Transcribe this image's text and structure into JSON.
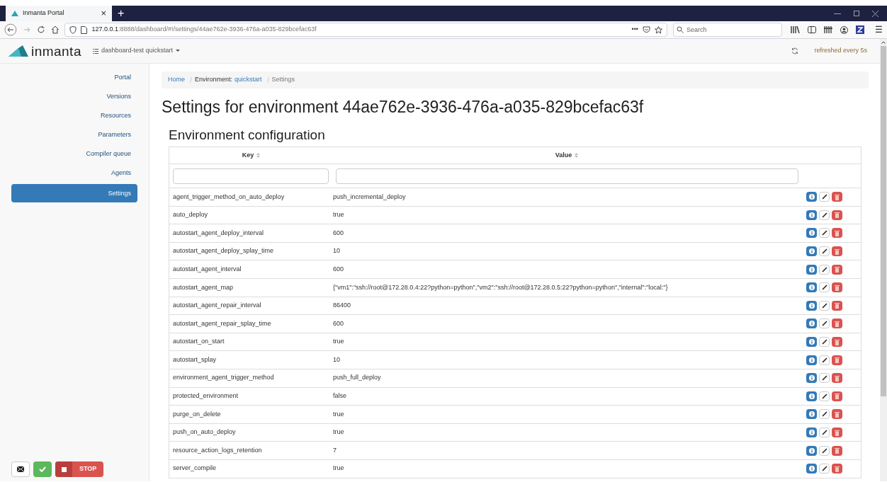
{
  "browser": {
    "tab_title": "Inmanta Portal",
    "close": "×",
    "new_tab": "+",
    "url_host": "127.0.0.1",
    "url_rest": ":8888/dashboard/#!/settings/44ae762e-3936-476a-a035-829bcefac63f",
    "more": "•••",
    "search_placeholder": "Search",
    "menu": "☰"
  },
  "header": {
    "logo": "inmanta",
    "environment": "dashboard-test quickstart",
    "refresh_status": "refreshed every 5s"
  },
  "sidebar": {
    "items": [
      {
        "label": "Portal",
        "selected": false
      },
      {
        "label": "Versions",
        "selected": false
      },
      {
        "label": "Resources",
        "selected": false
      },
      {
        "label": "Parameters",
        "selected": false
      },
      {
        "label": "Compiler queue",
        "selected": false
      },
      {
        "label": "Agents",
        "selected": false
      },
      {
        "label": "Settings",
        "selected": true
      }
    ],
    "footer": {
      "stop_label": "STOP"
    }
  },
  "breadcrumb": [
    {
      "label": "Home",
      "kind": "link"
    },
    {
      "label": "Environment:",
      "kind": "text"
    },
    {
      "label": "quickstart",
      "kind": "link"
    },
    {
      "label": "Settings",
      "kind": "current"
    }
  ],
  "title": "Settings for environment 44ae762e-3936-476a-a035-829bcefac63f",
  "section_title": "Environment configuration",
  "table": {
    "columns": [
      "Key",
      "Value"
    ],
    "rows": [
      {
        "key": "agent_trigger_method_on_auto_deploy",
        "value": "push_incremental_deploy"
      },
      {
        "key": "auto_deploy",
        "value": "true"
      },
      {
        "key": "autostart_agent_deploy_interval",
        "value": "600"
      },
      {
        "key": "autostart_agent_deploy_splay_time",
        "value": "10"
      },
      {
        "key": "autostart_agent_interval",
        "value": "600"
      },
      {
        "key": "autostart_agent_map",
        "value": "{\"vm1\":\"ssh://root@172.28.0.4:22?python=python\",\"vm2\":\"ssh://root@172.28.0.5:22?python=python\",\"internal\":\"local:\"}"
      },
      {
        "key": "autostart_agent_repair_interval",
        "value": "86400"
      },
      {
        "key": "autostart_agent_repair_splay_time",
        "value": "600"
      },
      {
        "key": "autostart_on_start",
        "value": "true"
      },
      {
        "key": "autostart_splay",
        "value": "10"
      },
      {
        "key": "environment_agent_trigger_method",
        "value": "push_full_deploy"
      },
      {
        "key": "protected_environment",
        "value": "false"
      },
      {
        "key": "purge_on_delete",
        "value": "true"
      },
      {
        "key": "push_on_auto_deploy",
        "value": "true"
      },
      {
        "key": "resource_action_logs_retention",
        "value": "7"
      },
      {
        "key": "server_compile",
        "value": "true"
      }
    ]
  }
}
